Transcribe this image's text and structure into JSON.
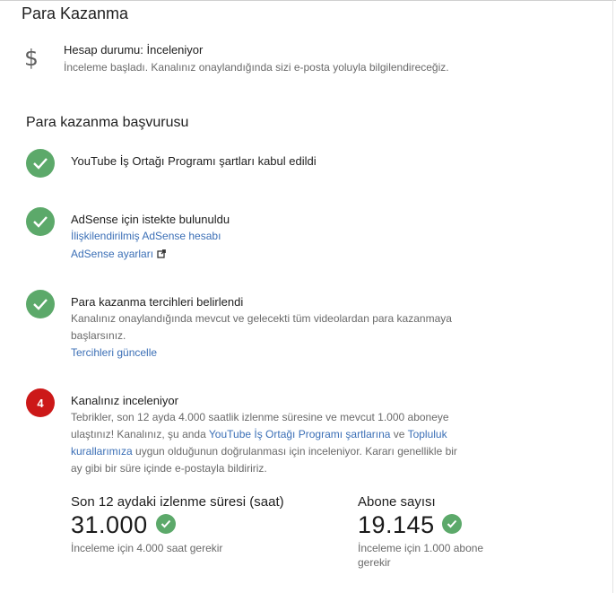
{
  "page_title": "Para Kazanma",
  "status": {
    "icon": "dollar-icon",
    "title": "Hesap durumu: İnceleniyor",
    "description": "İnceleme başladı. Kanalınız onaylandığında sizi e-posta yoluyla bilgilendireceğiz."
  },
  "section_title": "Para kazanma başvurusu",
  "steps": [
    {
      "icon": "check-icon",
      "title": "YouTube İş Ortağı Programı şartları kabul edildi"
    },
    {
      "icon": "check-icon",
      "title": "AdSense için istekte bulunuldu",
      "link1": "İlişkilendirilmiş AdSense hesabı",
      "link2": "AdSense ayarları"
    },
    {
      "icon": "check-icon",
      "title": "Para kazanma tercihleri belirlendi",
      "desc1": "Kanalınız onaylandığında mevcut ve gelecekti tüm videolardan para kazanmaya",
      "desc2": "başlarsınız.",
      "link": "Tercihleri güncelle"
    },
    {
      "number": "4",
      "title": "Kanalınız inceleniyor",
      "desc_line1": "Tebrikler, son 12 ayda 4.000 saatlik izlenme süresine ve mevcut 1.000 aboneye",
      "desc_line2_a": "ulaştınız! Kanalınız, şu anda ",
      "desc_line2_link1": "YouTube İş Ortağı Programı şartlarına",
      "desc_line2_b": " ve ",
      "desc_line2_link2": "Topluluk",
      "desc_line3_link": "kurallarımıza",
      "desc_line3_b": " uygun olduğunun doğrulanması için inceleniyor. Kararı genellikle bir",
      "desc_line4": "ay gibi bir süre içinde e-postayla bildiririz."
    }
  ],
  "metrics": [
    {
      "label": "Son 12 aydaki izlenme süresi (saat)",
      "value": "31.000",
      "requirement": "İnceleme için 4.000 saat gerekir"
    },
    {
      "label": "Abone sayısı",
      "value": "19.145",
      "requirement_line1": "İnceleme için 1.000 abone",
      "requirement_line2": "gerekir"
    }
  ],
  "colors": {
    "check": "#5ca96a",
    "badge": "#cc1818",
    "link": "#3b6fb6"
  }
}
